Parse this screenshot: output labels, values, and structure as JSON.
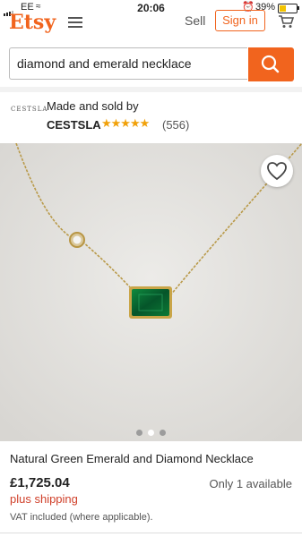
{
  "status": {
    "carrier": "EE",
    "time": "20:06",
    "battery": "39%",
    "battery_level": 0.39
  },
  "header": {
    "logo": "Etsy",
    "sell_label": "Sell",
    "signin_label": "Sign in"
  },
  "search": {
    "query": "diamond and emerald necklace"
  },
  "seller": {
    "logo_text": "CESTSLA",
    "made_label": "Made and sold by",
    "name": "CESTSLA",
    "rating": 5,
    "stars": "★★★★★",
    "reviews": "(556)"
  },
  "gallery": {
    "count": 3,
    "active": 2
  },
  "listing": {
    "title": "Natural Green Emerald and Diamond Necklace",
    "price": "£1,725.04",
    "availability": "Only 1 available",
    "shipping": "plus shipping",
    "vat": "VAT included (where applicable)."
  },
  "colors": {
    "brand": "#f1641e",
    "star": "#f1a10a",
    "shipping": "#d0402a"
  }
}
